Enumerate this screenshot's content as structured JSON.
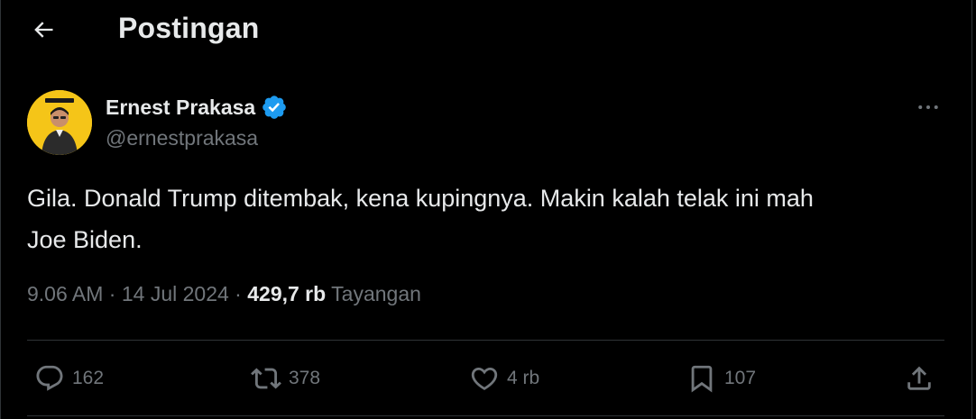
{
  "header": {
    "back_icon": "arrow-left-icon",
    "title": "Postingan"
  },
  "post": {
    "author": {
      "display_name": "Ernest Prakasa",
      "handle": "@ernestprakasa",
      "verified": true,
      "verified_color": "#1d9bf0",
      "avatar_bg": "#f5c518"
    },
    "text": "Gila. Donald Trump ditembak, kena kupingnya. Makin kalah telak ini mah\nJoe Biden.",
    "time": "9.06 AM",
    "date": "14 Jul 2024",
    "views_count": "429,7 rb",
    "views_label": "Tayangan",
    "separator": "·"
  },
  "actions": {
    "replies": "162",
    "reposts": "378",
    "likes": "4 rb",
    "bookmarks": "107"
  },
  "colors": {
    "background": "#000000",
    "text_primary": "#e7e9ea",
    "text_secondary": "#71767b",
    "border": "#2f3336"
  }
}
